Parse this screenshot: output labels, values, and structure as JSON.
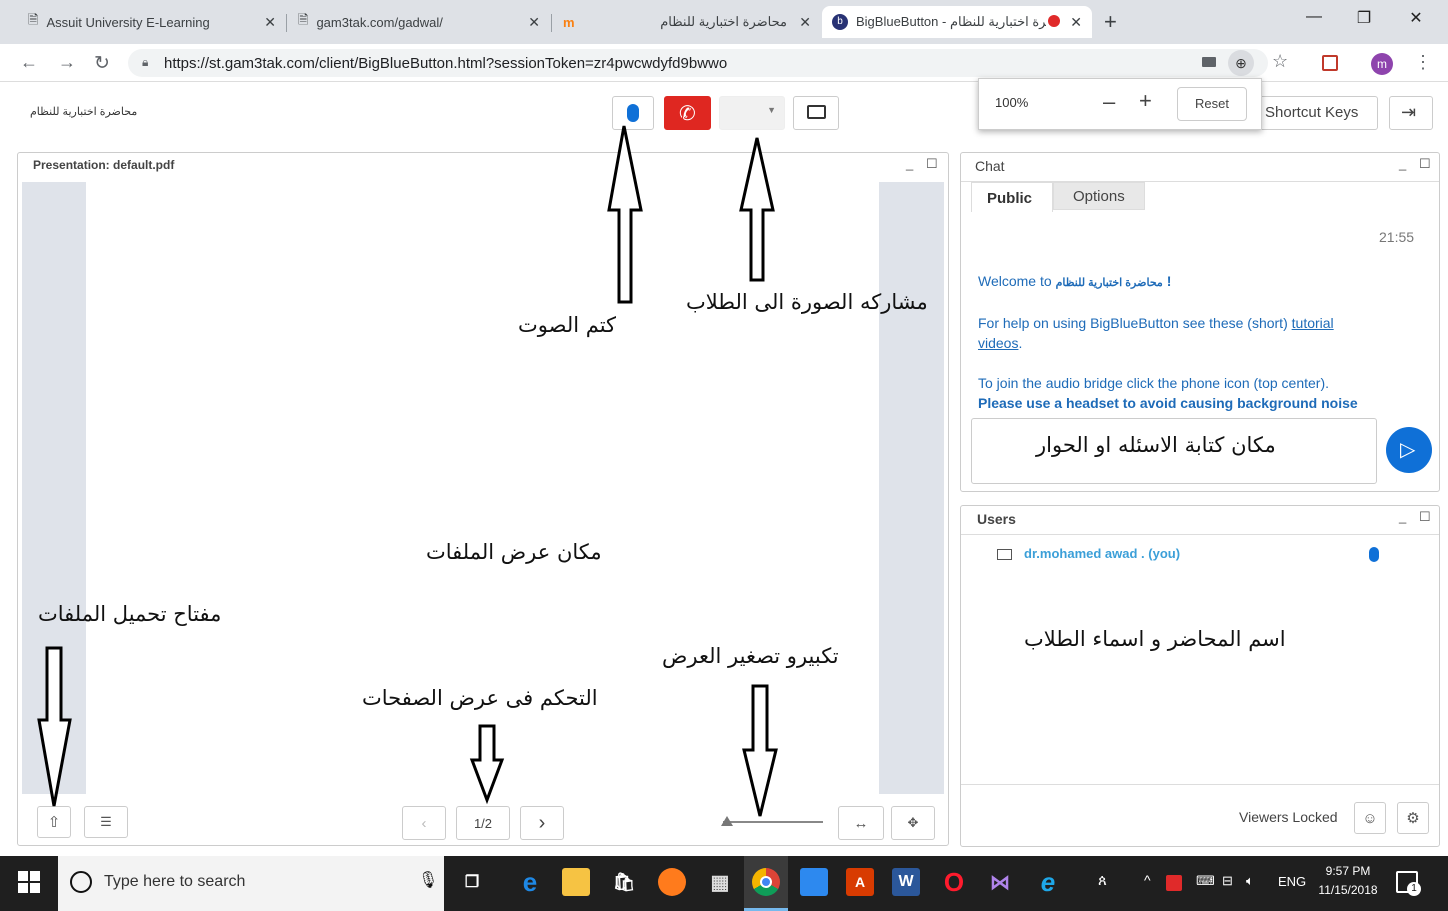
{
  "browser": {
    "tabs": [
      {
        "title": "Assuit University E-Learning",
        "icon": "page-icon"
      },
      {
        "title": "gam3tak.com/gadwal/",
        "icon": "page-icon"
      },
      {
        "title": "محاضرة اختبارية للنظام",
        "icon": "moodle-icon"
      },
      {
        "title": "BigBlueButton - محاضرة اختبارية للنظام",
        "icon": "bbb-icon"
      }
    ],
    "new_tab": "+",
    "url": "https://st.gam3tak.com/client/BigBlueButton.html?sessionToken=zr4pwcwdyfd9bwwo",
    "profile_initial": "m"
  },
  "zoom_popup": {
    "level": "100%",
    "minus": "–",
    "plus": "+",
    "reset": "Reset"
  },
  "header": {
    "meeting_title": "محاضرة اختبارية للنظام",
    "shortcut_keys": "Shortcut Keys"
  },
  "presentation": {
    "title": "Presentation: default.pdf",
    "page_indicator": "1/2"
  },
  "chat": {
    "title": "Chat",
    "tabs": [
      "Public",
      "Options"
    ],
    "time": "21:55",
    "welcome_prefix": "Welcome to",
    "welcome_name": "محاضرة اختبارية للنظام",
    "welcome_suffix": "!",
    "help_text": "For help on using BigBlueButton see these (short)",
    "help_link_1": "tutorial",
    "help_link_2": "videos",
    "help_period": ".",
    "audio_text": "To join the audio bridge click the phone icon (top center).",
    "headset_text": "Please use a headset to avoid causing background noise"
  },
  "users": {
    "title": "Users",
    "list": [
      {
        "name": "dr.mohamed awad . (you)"
      }
    ],
    "viewers_locked": "Viewers Locked"
  },
  "annotations": {
    "mute": "كتم الصوت",
    "share": "مشاركه الصورة الى الطلاب",
    "question_box": "مكان كتابة الاسئله او الحوار",
    "file_area": "مكان عرض الملفات",
    "upload_key": "مفتاح تحميل الملفات",
    "zoom": "تكبيرو تصغير العرض",
    "page_control": "التحكم فى عرض الصفحات",
    "users_label": "اسم المحاضر و اسماء الطلاب"
  },
  "taskbar": {
    "search_placeholder": "Type here to search",
    "language": "ENG",
    "time": "9:57 PM",
    "date": "11/15/2018",
    "notification_count": "1"
  },
  "colors": {
    "accent_blue": "#0f70d7",
    "hangup_red": "#df2721",
    "taskbar": "#1f1f1f"
  }
}
